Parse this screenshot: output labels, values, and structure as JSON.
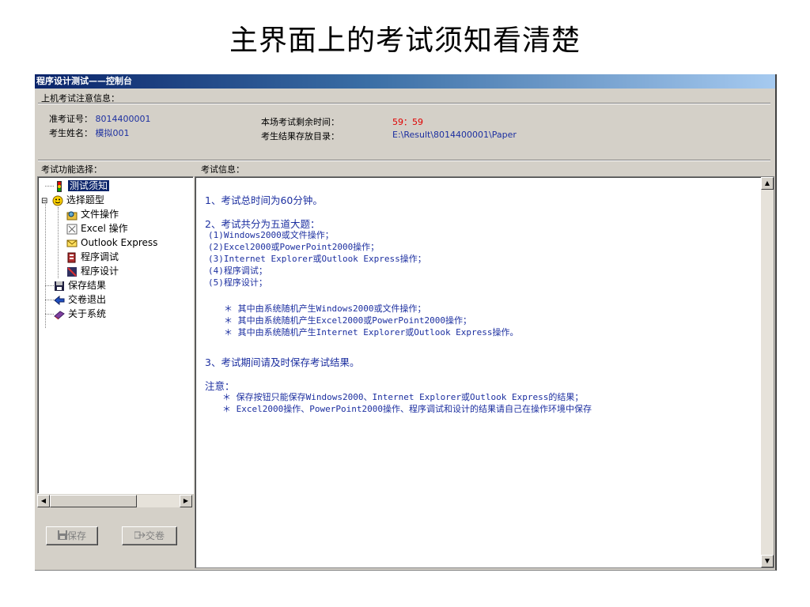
{
  "slide_title": "主界面上的考试须知看清楚",
  "window": {
    "title": "程序设计测试——控制台",
    "notice_label": "上机考试注意信息：",
    "exam_id_label": "准考证号：",
    "exam_id_value": "8014400001",
    "name_label": "考生姓名：",
    "name_value": "模拟001",
    "time_left_label": "本场考试剩余时间：",
    "time_left_value": "59：59",
    "result_dir_label": "考生结果存放目录：",
    "result_dir_value": "E:\\Result\\8014400001\\Paper",
    "func_label": "考试功能选择：",
    "info_label": "考试信息："
  },
  "tree": [
    {
      "label": "测试须知",
      "icon": "traffic-light-icon",
      "selected": true
    },
    {
      "label": "选择题型",
      "icon": "smiley-icon",
      "expander": "⊟"
    },
    {
      "label": "文件操作",
      "icon": "folder-search-icon"
    },
    {
      "label": "Excel 操作",
      "icon": "excel-icon"
    },
    {
      "label": "Outlook Express",
      "icon": "mail-icon"
    },
    {
      "label": "程序调试",
      "icon": "debug-icon"
    },
    {
      "label": "程序设计",
      "icon": "design-icon"
    },
    {
      "label": "保存结果",
      "icon": "floppy-icon"
    },
    {
      "label": "交卷退出",
      "icon": "exit-arrow-icon"
    },
    {
      "label": "关于系统",
      "icon": "book-icon"
    }
  ],
  "buttons": {
    "save": "保存",
    "submit": "交卷"
  },
  "content": {
    "p1": "1、考试总时间为60分钟。",
    "p2": "2、考试共分为五道大题：",
    "items": [
      "(1)Windows2000或文件操作；",
      "(2)Excel2000或PowerPoint2000操作；",
      "(3)Internet Explorer或Outlook Express操作；",
      "(4)程序调试；",
      "(5)程序设计；"
    ],
    "stars": [
      "＊ 其中由系统随机产生Windows2000或文件操作；",
      "＊ 其中由系统随机产生Excel2000或PowerPoint2000操作；",
      "＊ 其中由系统随机产生Internet Explorer或Outlook Express操作。"
    ],
    "p3": "3、考试期间请及时保存考试结果。",
    "note_label": "注意：",
    "notes": [
      "＊ 保存按钮只能保存Windows2000、Internet Explorer或Outlook Express的结果；",
      "＊ Excel2000操作、PowerPoint2000操作、程序调试和设计的结果请自己在操作环境中保存"
    ]
  }
}
